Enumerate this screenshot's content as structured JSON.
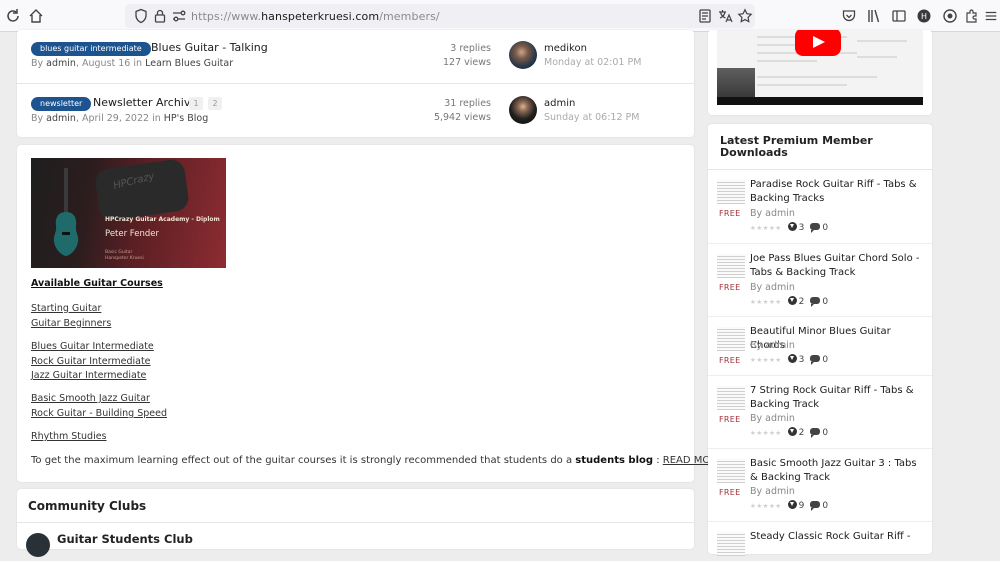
{
  "browser": {
    "url_prefix": "https://www.",
    "url_host": "hanspeterkruesi.com",
    "url_path": "/members/",
    "icons": [
      "reload-icon",
      "home-icon",
      "shield-icon",
      "lock-icon",
      "permissions-icon",
      "reader-view-icon",
      "translate-icon",
      "bookmark-star-icon",
      "pocket-icon",
      "library-icon",
      "sidebar-icon",
      "profile-icon",
      "extension-icon",
      "extensions-icon",
      "menu-icon"
    ]
  },
  "topics": [
    {
      "tag": "blues guitar intermediate",
      "title": "Blues Guitar - Talking",
      "pages": [],
      "author": "admin",
      "date": "August 16",
      "forum": "Learn Blues Guitar",
      "replies": "3 replies",
      "views": "127 views",
      "last_user": "medikon",
      "last_date": "Monday at 02:01 PM"
    },
    {
      "tag": "newsletter",
      "title": "Newsletter Archiv",
      "pages": [
        "1",
        "2"
      ],
      "author": "admin",
      "date": "April 29, 2022",
      "forum": "HP's Blog",
      "replies": "31 replies",
      "views": "5,942 views",
      "last_user": "admin",
      "last_date": "Sunday at 06:12 PM"
    }
  ],
  "labels": {
    "by": "By",
    "in": "in"
  },
  "banner": {
    "patch": "HPCrazy",
    "line1": "HPCrazy Guitar Academy - Diplom",
    "line2": "Peter Fender",
    "line3a": "Basic Guitar",
    "line3b": "Hanspeter Kruesi"
  },
  "courses": {
    "heading": "Available Guitar Courses",
    "links": [
      "Starting Guitar",
      "Guitar Beginners",
      "Blues Guitar Intermediate",
      "Rock Guitar Intermediate",
      "Jazz Guitar Intermediate",
      "Basic Smooth Jazz Guitar",
      "Rock Guitar - Building Speed",
      "Rhythm Studies"
    ],
    "note_pre": "To get the maximum learning effect out of the guitar courses it is strongly recommended that students do a ",
    "note_bold": "students blog",
    "note_sep": " : ",
    "note_link": "READ MORE"
  },
  "clubs": {
    "title": "Community Clubs",
    "first": "Guitar Students Club"
  },
  "downloads": {
    "title": "Latest Premium Member Downloads",
    "free_label": "FREE",
    "stars": "★★★★★",
    "items": [
      {
        "title": "Paradise Rock Guitar Riff - Tabs & Backing Tracks",
        "author": "admin",
        "downloads": "3",
        "comments": "0"
      },
      {
        "title": "Joe Pass Blues Guitar Chord Solo - Tabs & Backing Track",
        "author": "admin",
        "downloads": "2",
        "comments": "0"
      },
      {
        "title": "Beautiful Minor Blues Guitar Chords",
        "author": "admin",
        "downloads": "3",
        "comments": "0"
      },
      {
        "title": "7 String Rock Guitar Riff - Tabs & Backing Track",
        "author": "admin",
        "downloads": "2",
        "comments": "0"
      },
      {
        "title": "Basic Smooth Jazz Guitar 3 : Tabs & Backing Track",
        "author": "admin",
        "downloads": "9",
        "comments": "0"
      },
      {
        "title": "Steady Classic Rock Guitar Riff -",
        "author": "",
        "downloads": "",
        "comments": ""
      }
    ]
  },
  "colors": {
    "tag_bg": "#1d5490",
    "free": "#a0323a",
    "youtube": "#ff0000"
  }
}
